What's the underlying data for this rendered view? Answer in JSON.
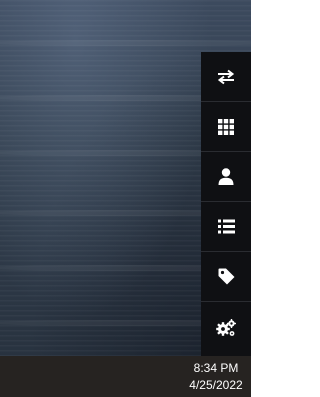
{
  "side_panel": {
    "items": [
      {
        "icon": "swap-arrows-icon"
      },
      {
        "icon": "grid-icon"
      },
      {
        "icon": "user-icon"
      },
      {
        "icon": "list-icon"
      },
      {
        "icon": "tag-icon"
      },
      {
        "icon": "cogs-icon"
      }
    ]
  },
  "taskbar": {
    "time": "8:34 PM",
    "date": "4/25/2022"
  },
  "colors": {
    "panel_background": "#0f1013",
    "taskbar_background": "#262321",
    "icon_color": "#ffffff"
  }
}
